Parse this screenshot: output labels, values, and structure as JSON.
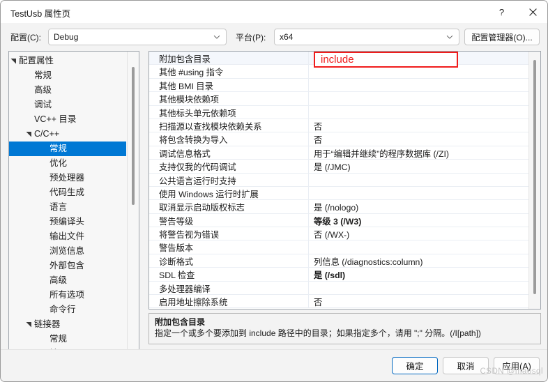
{
  "window": {
    "title": "TestUsb 属性页",
    "help_icon": "question-mark-icon",
    "close_icon": "close-icon"
  },
  "config_bar": {
    "configuration_label": "配置(C):",
    "configuration_value": "Debug",
    "platform_label": "平台(P):",
    "platform_value": "x64",
    "config_manager_button": "配置管理器(O)...",
    "chevron_icon": "chevron-down-icon"
  },
  "tree": {
    "items": [
      {
        "label": "配置属性",
        "indent": 0,
        "arrow": "expanded-triangle-icon",
        "selected": false
      },
      {
        "label": "常规",
        "indent": 1,
        "arrow": "",
        "selected": false
      },
      {
        "label": "高级",
        "indent": 1,
        "arrow": "",
        "selected": false
      },
      {
        "label": "调试",
        "indent": 1,
        "arrow": "",
        "selected": false
      },
      {
        "label": "VC++ 目录",
        "indent": 1,
        "arrow": "",
        "selected": false
      },
      {
        "label": "C/C++",
        "indent": 1,
        "arrow": "expanded-triangle-icon",
        "selected": false
      },
      {
        "label": "常规",
        "indent": 2,
        "arrow": "",
        "selected": true
      },
      {
        "label": "优化",
        "indent": 2,
        "arrow": "",
        "selected": false
      },
      {
        "label": "预处理器",
        "indent": 2,
        "arrow": "",
        "selected": false
      },
      {
        "label": "代码生成",
        "indent": 2,
        "arrow": "",
        "selected": false
      },
      {
        "label": "语言",
        "indent": 2,
        "arrow": "",
        "selected": false
      },
      {
        "label": "预编译头",
        "indent": 2,
        "arrow": "",
        "selected": false
      },
      {
        "label": "输出文件",
        "indent": 2,
        "arrow": "",
        "selected": false
      },
      {
        "label": "浏览信息",
        "indent": 2,
        "arrow": "",
        "selected": false
      },
      {
        "label": "外部包含",
        "indent": 2,
        "arrow": "",
        "selected": false
      },
      {
        "label": "高级",
        "indent": 2,
        "arrow": "",
        "selected": false
      },
      {
        "label": "所有选项",
        "indent": 2,
        "arrow": "",
        "selected": false
      },
      {
        "label": "命令行",
        "indent": 2,
        "arrow": "",
        "selected": false
      },
      {
        "label": "链接器",
        "indent": 1,
        "arrow": "expanded-triangle-icon",
        "selected": false
      },
      {
        "label": "常规",
        "indent": 2,
        "arrow": "",
        "selected": false
      },
      {
        "label": "输入",
        "indent": 2,
        "arrow": "",
        "selected": false
      }
    ]
  },
  "grid": {
    "rows": [
      {
        "name": "附加包含目录",
        "value": "",
        "bold": false,
        "selected": true,
        "edit": true
      },
      {
        "name": "其他 #using 指令",
        "value": "",
        "bold": false
      },
      {
        "name": "其他 BMI 目录",
        "value": "",
        "bold": false
      },
      {
        "name": "其他模块依赖项",
        "value": "",
        "bold": false
      },
      {
        "name": "其他标头单元依赖项",
        "value": "",
        "bold": false
      },
      {
        "name": "扫描源以查找模块依赖关系",
        "value": "否",
        "bold": false
      },
      {
        "name": "将包含转换为导入",
        "value": "否",
        "bold": false
      },
      {
        "name": "调试信息格式",
        "value": "用于“编辑并继续”的程序数据库 (/ZI)",
        "bold": false
      },
      {
        "name": "支持仅我的代码调试",
        "value": "是 (/JMC)",
        "bold": false
      },
      {
        "name": "公共语言运行时支持",
        "value": "",
        "bold": false
      },
      {
        "name": "使用 Windows 运行时扩展",
        "value": "",
        "bold": false
      },
      {
        "name": "取消显示启动版权标志",
        "value": "是 (/nologo)",
        "bold": false
      },
      {
        "name": "警告等级",
        "value": "等级 3 (/W3)",
        "bold": true
      },
      {
        "name": "将警告视为错误",
        "value": "否 (/WX-)",
        "bold": false
      },
      {
        "name": "警告版本",
        "value": "",
        "bold": false
      },
      {
        "name": "诊断格式",
        "value": "列信息 (/diagnostics:column)",
        "bold": false
      },
      {
        "name": "SDL 检查",
        "value": "是 (/sdl)",
        "bold": true
      },
      {
        "name": "多处理器编译",
        "value": "",
        "bold": false
      },
      {
        "name": "启用地址擦除系统",
        "value": "否",
        "bold": false
      }
    ],
    "edit_value": "include",
    "highlight_color": "#f01c1c"
  },
  "description": {
    "title": "附加包含目录",
    "body": "指定一个或多个要添加到 include 路径中的目录；如果指定多个，请用 \";\" 分隔。(/I[path])"
  },
  "footer": {
    "ok": "确定",
    "cancel": "取消",
    "apply": "应用(A)"
  },
  "watermark": "CSDN @maosql",
  "colors": {
    "selection_blue": "#0078d4",
    "highlight_red": "#f01c1c",
    "primary_border": "#0067c0"
  }
}
